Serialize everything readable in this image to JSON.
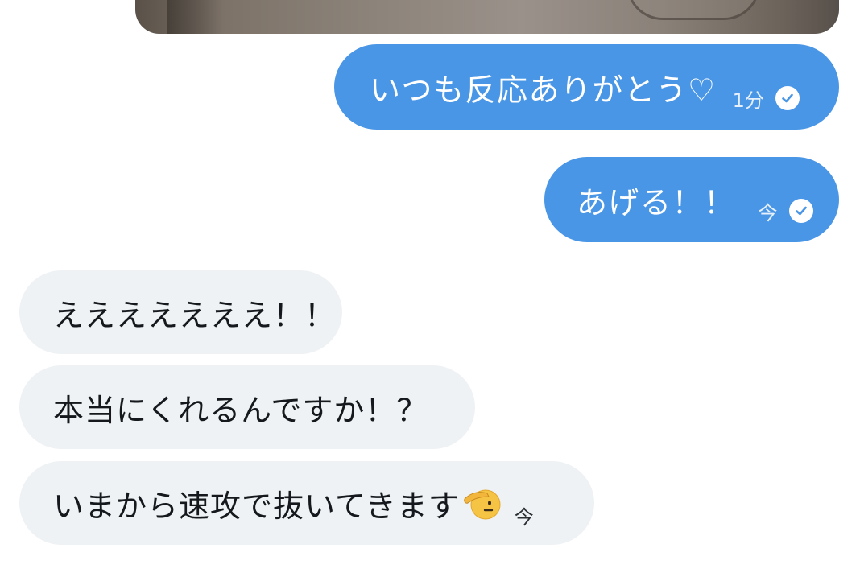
{
  "conversation": {
    "sent": [
      {
        "text": "いつも反応ありがとう♡",
        "time": "1分",
        "status_icon": "read-check-icon"
      },
      {
        "text": "あげる！！",
        "time": "今",
        "status_icon": "read-check-icon"
      }
    ],
    "received": [
      {
        "text": "えええええええ！！"
      },
      {
        "text": "本当にくれるんですか！？"
      },
      {
        "text": "いまから速攻で抜いてきます",
        "emoji": "saluting-face-emoji",
        "time": "今"
      }
    ]
  },
  "colors": {
    "sent_bubble": "#4a96e6",
    "received_bubble": "#eff2f4",
    "sent_text": "#ffffff",
    "received_text": "#15181c"
  }
}
